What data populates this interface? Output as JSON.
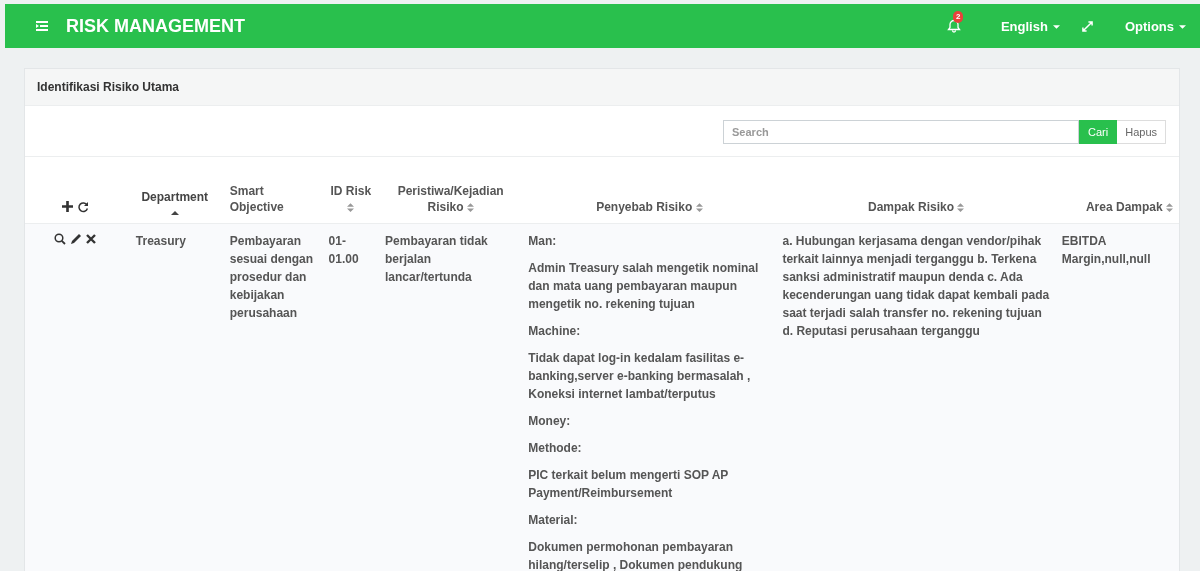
{
  "header": {
    "title": "RISK MANAGEMENT",
    "notification_count": "2",
    "language": "English",
    "options": "Options"
  },
  "panel": {
    "title": "Identifikasi Risiko Utama"
  },
  "search": {
    "placeholder": "Search",
    "search_button": "Cari",
    "clear_button": "Hapus"
  },
  "table": {
    "columns": [
      {
        "label": "Department",
        "sortable": true,
        "sorted": true
      },
      {
        "label": "Smart Objective",
        "sortable": false,
        "sorted": false
      },
      {
        "label": "ID Risk",
        "sortable": true,
        "sorted": false
      },
      {
        "label": "Peristiwa/Kejadian Risiko",
        "sortable": true,
        "sorted": false
      },
      {
        "label": "Penyebab Risiko",
        "sortable": true,
        "sorted": false
      },
      {
        "label": "Dampak Risiko",
        "sortable": true,
        "sorted": false
      },
      {
        "label": "Area Dampak",
        "sortable": true,
        "sorted": false
      }
    ],
    "rows": [
      {
        "department": "Treasury",
        "smart_objective": "Pembayaran sesuai dengan prosedur dan kebijakan perusahaan",
        "id_risk": "01-01.00",
        "event": "Pembayaran tidak berjalan lancar/tertunda",
        "causes": [
          "Man:",
          "Admin Treasury salah mengetik nominal dan mata uang pembayaran maupun mengetik no. rekening tujuan",
          "Machine:",
          "Tidak dapat log-in kedalam fasilitas e-banking,server e-banking bermasalah , Koneksi internet lambat/terputus",
          "Money:",
          "Methode:",
          "PIC terkait belum mengerti SOP AP Payment/Reimbursement",
          "Material:",
          "Dokumen permohonan pembayaran hilang/terselip , Dokumen pendukung"
        ],
        "impact": "a. Hubungan kerjasama dengan vendor/pihak terkait lainnya menjadi terganggu b. Terkena sanksi administratif maupun denda c. Ada kecenderungan uang tidak dapat kembali pada saat terjadi salah transfer no. rekening tujuan d. Reputasi perusahaan terganggu",
        "impact_area": "EBITDA Margin,null,null"
      }
    ]
  }
}
